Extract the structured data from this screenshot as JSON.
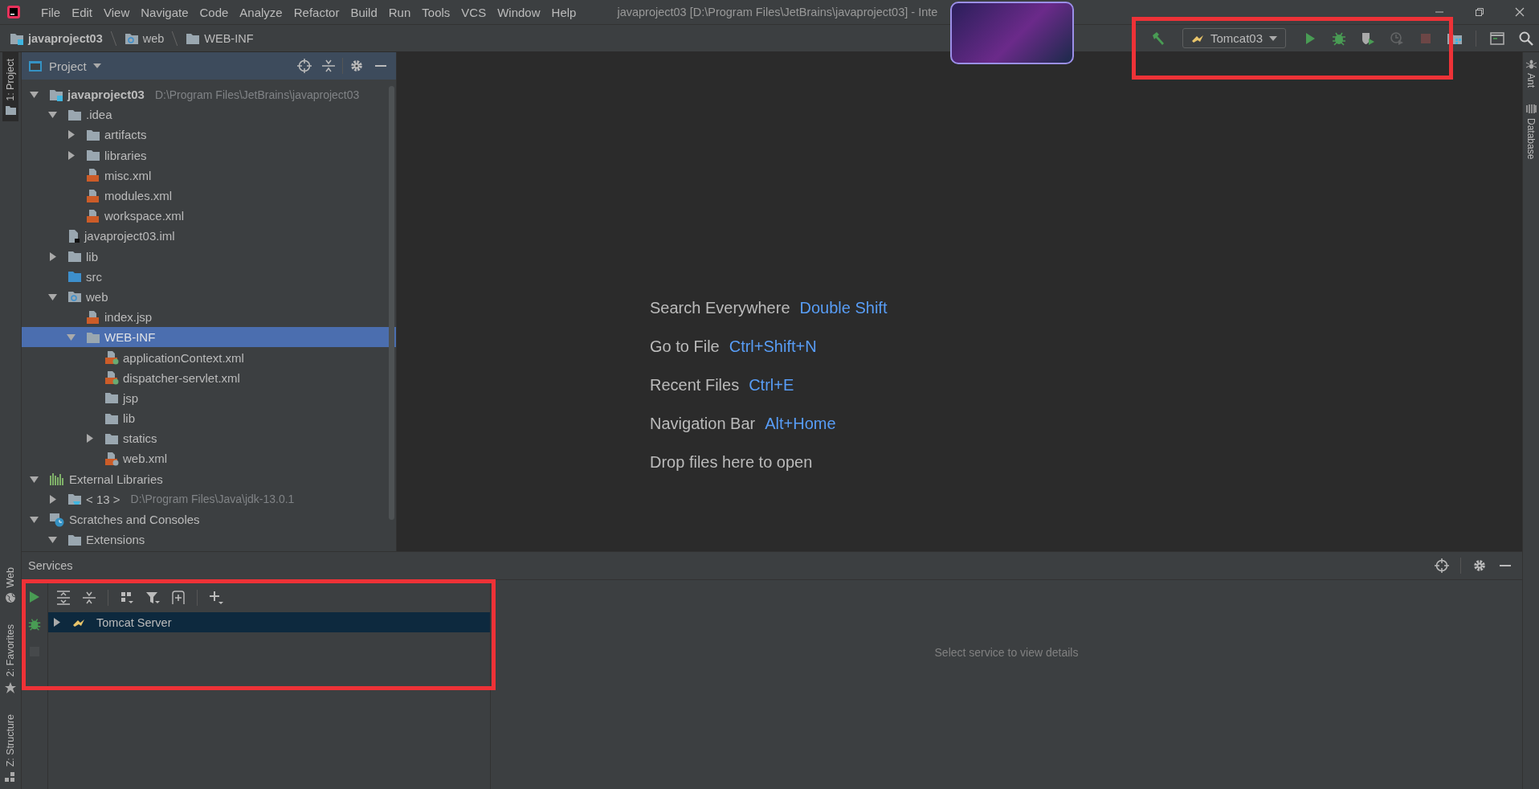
{
  "menu_bar": {
    "items": [
      "File",
      "Edit",
      "View",
      "Navigate",
      "Code",
      "Analyze",
      "Refactor",
      "Build",
      "Run",
      "Tools",
      "VCS",
      "Window",
      "Help"
    ],
    "title": "javaproject03 [D:\\Program Files\\JetBrains\\javaproject03] - Inte"
  },
  "breadcrumbs": [
    {
      "label": "javaproject03",
      "kind": "project"
    },
    {
      "label": "web",
      "kind": "web-folder"
    },
    {
      "label": "WEB-INF",
      "kind": "folder"
    }
  ],
  "toolbar": {
    "run_config": "Tomcat03",
    "buttons": [
      {
        "kind": "build",
        "disabled": false
      },
      {
        "kind": "run",
        "disabled": false
      },
      {
        "kind": "debug",
        "disabled": false
      },
      {
        "kind": "coverage",
        "disabled": false
      },
      {
        "kind": "profile",
        "disabled": true
      },
      {
        "kind": "stop",
        "disabled": true
      },
      {
        "kind": "structure",
        "disabled": false
      },
      {
        "kind": "terminal",
        "disabled": false
      },
      {
        "kind": "search",
        "disabled": false
      }
    ]
  },
  "left_stripe": {
    "top": [
      {
        "label": "1: Project",
        "selected": true
      }
    ],
    "bottom": [
      {
        "label": "Web",
        "selected": false
      },
      {
        "label": "2: Favorites",
        "selected": false
      },
      {
        "label": "Z: Structure",
        "selected": false
      }
    ]
  },
  "right_stripe": [
    {
      "label": "Ant",
      "kind": "ant"
    },
    {
      "label": "Database",
      "kind": "database"
    }
  ],
  "project_panel": {
    "title": "Project",
    "items": [
      {
        "label": "javaproject03",
        "path": "D:\\Program Files\\JetBrains\\javaproject03",
        "kind": "project",
        "expanded": true,
        "selected": false,
        "children": [
          {
            "label": ".idea",
            "kind": "folder",
            "expanded": true,
            "selected": false,
            "children": [
              {
                "label": "artifacts",
                "kind": "folder",
                "expanded": false,
                "selected": false
              },
              {
                "label": "libraries",
                "kind": "folder",
                "expanded": false,
                "selected": false
              },
              {
                "label": "misc.xml",
                "kind": "xml",
                "selected": false
              },
              {
                "label": "modules.xml",
                "kind": "xml",
                "selected": false
              },
              {
                "label": "workspace.xml",
                "kind": "xml",
                "selected": false
              }
            ]
          },
          {
            "label": "javaproject03.iml",
            "kind": "iml",
            "selected": false
          },
          {
            "label": "lib",
            "kind": "folder",
            "expanded": false,
            "selected": false
          },
          {
            "label": "src",
            "kind": "source-folder",
            "selected": false
          },
          {
            "label": "web",
            "kind": "web-folder",
            "expanded": true,
            "selected": false,
            "children": [
              {
                "label": "index.jsp",
                "kind": "jsp",
                "selected": false
              },
              {
                "label": "WEB-INF",
                "kind": "folder",
                "expanded": true,
                "selected": true,
                "children": [
                  {
                    "label": "applicationContext.xml",
                    "kind": "spring-xml",
                    "selected": false
                  },
                  {
                    "label": "dispatcher-servlet.xml",
                    "kind": "spring-xml",
                    "selected": false
                  },
                  {
                    "label": "jsp",
                    "kind": "folder",
                    "selected": false
                  },
                  {
                    "label": "lib",
                    "kind": "folder",
                    "selected": false
                  },
                  {
                    "label": "statics",
                    "kind": "folder",
                    "expanded": false,
                    "selected": false
                  },
                  {
                    "label": "web.xml",
                    "kind": "web-xml",
                    "selected": false
                  }
                ]
              }
            ]
          }
        ]
      },
      {
        "label": "External Libraries",
        "kind": "libraries",
        "expanded": true,
        "selected": false,
        "children": [
          {
            "label": "< 13 >",
            "path": "D:\\Program Files\\Java\\jdk-13.0.1",
            "kind": "sdk",
            "expanded": false,
            "selected": false
          }
        ]
      },
      {
        "label": "Scratches and Consoles",
        "kind": "scratches",
        "expanded": true,
        "selected": false,
        "children": [
          {
            "label": "Extensions",
            "kind": "folder",
            "expanded": true,
            "selected": false
          }
        ]
      }
    ]
  },
  "editor": {
    "hints": [
      {
        "text": "Search Everywhere",
        "shortcut": "Double Shift"
      },
      {
        "text": "Go to File",
        "shortcut": "Ctrl+Shift+N"
      },
      {
        "text": "Recent Files",
        "shortcut": "Ctrl+E"
      },
      {
        "text": "Navigation Bar",
        "shortcut": "Alt+Home"
      },
      {
        "text": "Drop files here to open"
      }
    ]
  },
  "services": {
    "title": "Services",
    "actions": [
      {
        "kind": "run",
        "disabled": false
      },
      {
        "kind": "debug",
        "disabled": false
      },
      {
        "kind": "stop",
        "disabled": true
      }
    ],
    "items": [
      {
        "label": "Tomcat Server",
        "expanded": false,
        "selected": true
      }
    ],
    "empty_text": "Select service to view details"
  }
}
